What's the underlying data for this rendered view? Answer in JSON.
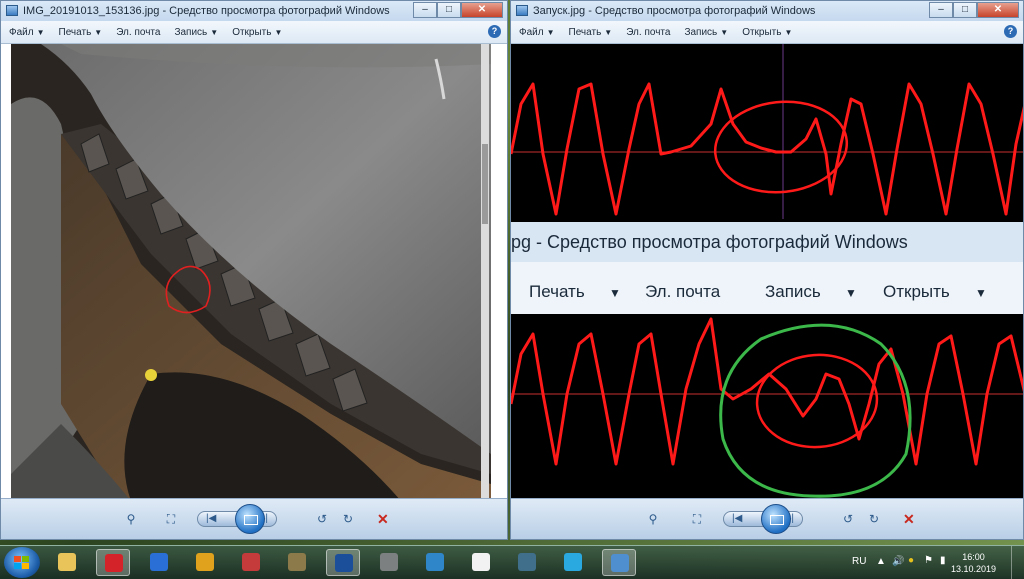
{
  "left_window": {
    "title": "IMG_20191013_153136.jpg - Средство просмотра фотографий Windows",
    "menu": [
      {
        "label": "Файл",
        "has_arrow": true
      },
      {
        "label": "Печать",
        "has_arrow": true
      },
      {
        "label": "Эл. почта",
        "has_arrow": false
      },
      {
        "label": "Запись",
        "has_arrow": true
      },
      {
        "label": "Открыть",
        "has_arrow": true
      }
    ],
    "help": "?"
  },
  "right_window": {
    "title": "Запуск.jpg - Средство просмотра фотографий Windows",
    "menu": [
      {
        "label": "Файл",
        "has_arrow": true
      },
      {
        "label": "Печать",
        "has_arrow": true
      },
      {
        "label": "Эл. почта",
        "has_arrow": false
      },
      {
        "label": "Запись",
        "has_arrow": true
      },
      {
        "label": "Открыть",
        "has_arrow": true
      }
    ],
    "help": "?",
    "embedded_title": "pg - Средство просмотра фотографий Windows",
    "embedded_menu": [
      "Печать",
      "Эл. почта",
      "Запись",
      "Открыть"
    ]
  },
  "window_buttons": {
    "min": "–",
    "max": "□",
    "close": "✕"
  },
  "viewer_controls": {
    "zoom": "⚲",
    "fit": "⛶",
    "prev": "|◀",
    "next": "▶|",
    "rotate_ccw": "↺",
    "rotate_cw": "↻",
    "delete": "✕"
  },
  "tray": {
    "language": "RU",
    "time": "16:00",
    "date": "13.10.2019"
  },
  "taskbar_items": [
    {
      "name": "explorer",
      "color": "#e8c45a"
    },
    {
      "name": "opera",
      "color": "#d4242a",
      "active": true
    },
    {
      "name": "app-blue",
      "color": "#2a6fd6"
    },
    {
      "name": "app-yellow",
      "color": "#e0a21c"
    },
    {
      "name": "app-red",
      "color": "#c53a3a"
    },
    {
      "name": "app-mixed",
      "color": "#8c7a4a"
    },
    {
      "name": "oscilloscope",
      "color": "#1b4f9a",
      "active": true
    },
    {
      "name": "app-grey",
      "color": "#7d8080"
    },
    {
      "name": "app-tv",
      "color": "#2f86c9"
    },
    {
      "name": "app-vasya",
      "color": "#f2f2f2"
    },
    {
      "name": "app-monitor",
      "color": "#3f6f8a"
    },
    {
      "name": "app-edge",
      "color": "#2aa8e0"
    },
    {
      "name": "photo-viewer",
      "color": "#4f8fd0",
      "active": true
    }
  ]
}
